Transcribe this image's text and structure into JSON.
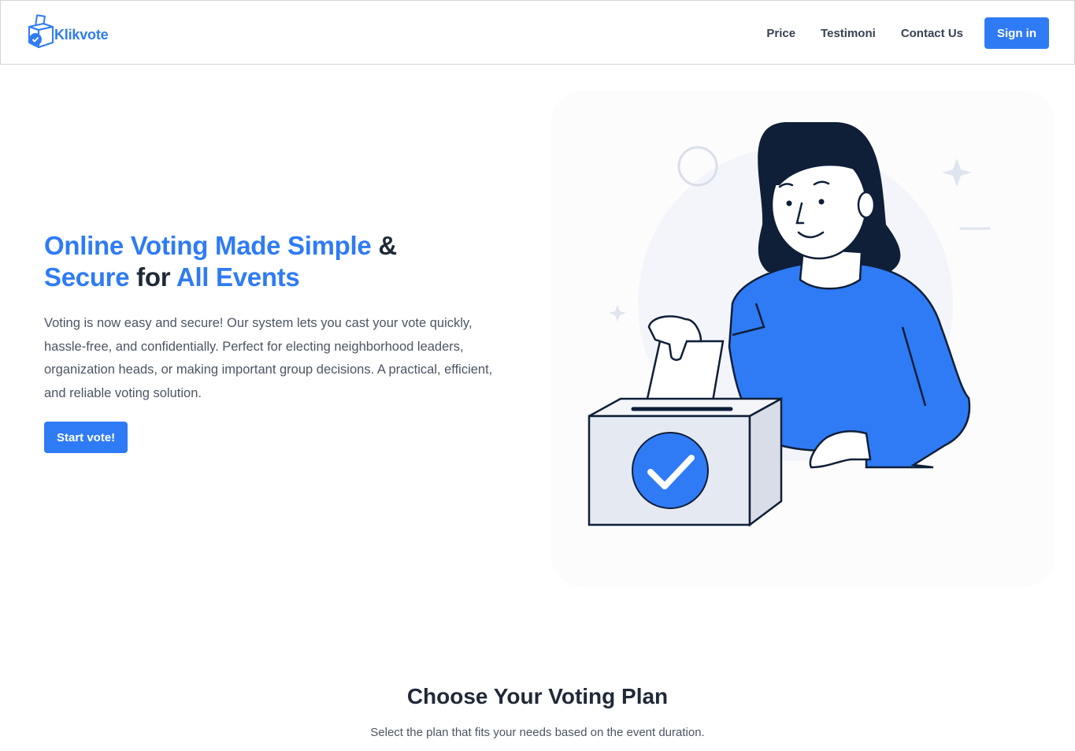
{
  "brand": {
    "name": "Klikvote",
    "color": "#2f7bf5",
    "logo_icon": "ballot-box-check-icon"
  },
  "nav": {
    "links": [
      "Price",
      "Testimoni",
      "Contact Us"
    ],
    "signin_label": "Sign in"
  },
  "hero": {
    "title_part1": "Online Voting Made Simple",
    "title_part2": "&",
    "title_part3": "Secure",
    "title_part4": "for",
    "title_part5": "All Events",
    "description": "Voting is now easy and secure! Our system lets you cast your vote quickly, hassle-free, and confidentially. Perfect for electing neighborhood leaders, organization heads, or making important group decisions. A practical, efficient, and reliable voting solution.",
    "cta_label": "Start vote!",
    "illustration": "woman-casting-ballot-illustration"
  },
  "plans": {
    "title": "Choose Your Voting Plan",
    "subtitle": "Select the plan that fits your needs based on the event duration."
  },
  "colors": {
    "accent": "#2f7bf5",
    "dark_text": "#1f2937",
    "body_text": "#4b5563",
    "hair": "#0f1f38"
  }
}
